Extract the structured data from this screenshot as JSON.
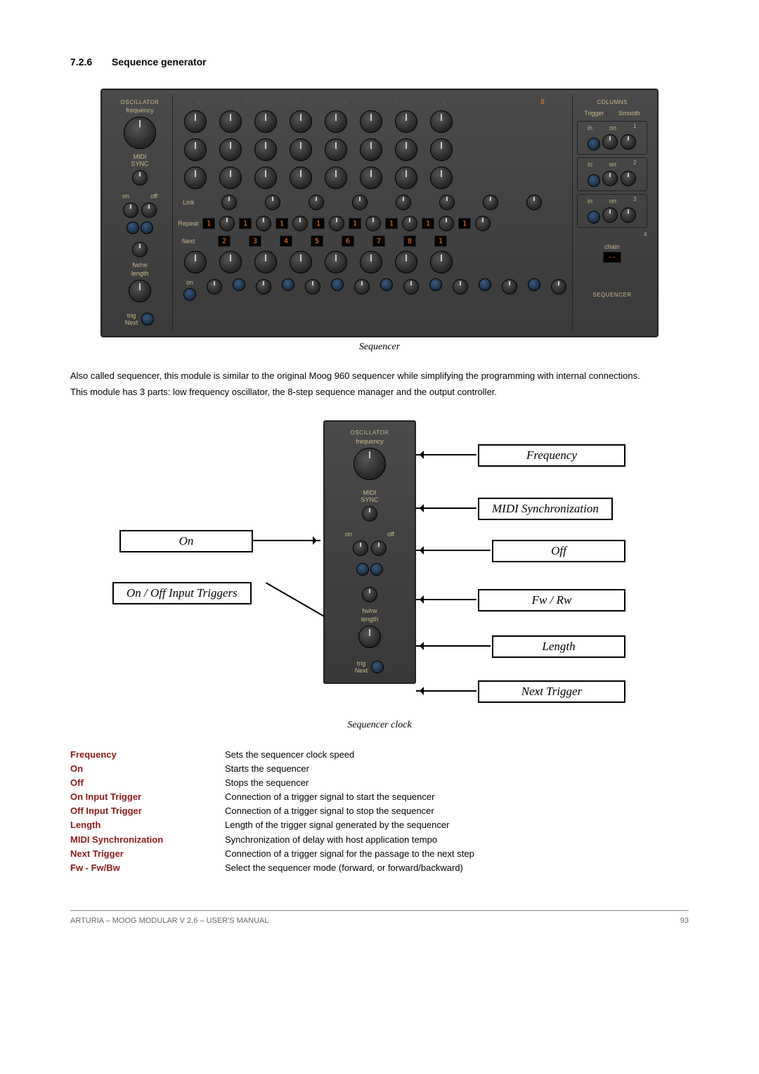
{
  "section": {
    "number": "7.2.6",
    "title": "Sequence generator"
  },
  "panel": {
    "osc_label": "OSCILLATOR",
    "freq_label": "frequency",
    "midi_sync": "MIDI\nSYNC",
    "on": "on",
    "off": "off",
    "fwrw": "fw/rw",
    "length": "length",
    "trig_next": "trig\nNext",
    "columns": "COLUMNS",
    "trigger": "Trigger",
    "smooth": "Smooth",
    "in": "in",
    "link": "Link",
    "repeat": "Repeat",
    "next": "Next",
    "chain": "chain",
    "chain_val": "--",
    "sequencer": "SEQUENCER",
    "step_nums": [
      "1",
      "2",
      "3",
      "4",
      "5",
      "6",
      "7",
      "8"
    ],
    "repeat_vals": [
      "1",
      "1",
      "1",
      "1",
      "1",
      "1",
      "1",
      "1"
    ],
    "next_vals": [
      "2",
      "3",
      "4",
      "5",
      "6",
      "7",
      "8",
      "1"
    ]
  },
  "captions": {
    "seq": "Sequencer",
    "clock": "Sequencer clock"
  },
  "paragraphs": {
    "p1": "Also called sequencer, this module is similar to the original Moog 960 sequencer while simplifying the programming with internal connections.",
    "p2": "This module has 3 parts: low frequency oscillator, the 8-step sequence manager and the output controller."
  },
  "clock_labels": {
    "frequency": "Frequency",
    "midi_sync": "MIDI Synchronization",
    "on": "On",
    "off": "Off",
    "onoff_trig": "On / Off Input Triggers",
    "fwrw": "Fw / Rw",
    "length": "Length",
    "next_trigger": "Next Trigger"
  },
  "defs": [
    {
      "term": "Frequency",
      "desc": "Sets the sequencer clock speed"
    },
    {
      "term": "On",
      "desc": "Starts the sequencer"
    },
    {
      "term": "Off",
      "desc": "Stops the sequencer"
    },
    {
      "term": "On Input Trigger",
      "desc": "Connection of a trigger signal to start the sequencer"
    },
    {
      "term": "Off Input Trigger",
      "desc": "Connection of a trigger signal to stop the sequencer"
    },
    {
      "term": "Length",
      "desc": "Length of the trigger signal generated by the sequencer"
    },
    {
      "term": "MIDI Synchronization",
      "desc": "Synchronization of delay with host application tempo"
    },
    {
      "term": "Next Trigger",
      "desc": "Connection of a trigger signal for the passage to the next step"
    },
    {
      "term": "Fw - Fw/Bw",
      "desc": "Select the sequencer mode (forward, or forward/backward)"
    }
  ],
  "footer": {
    "left": "ARTURIA – MOOG MODULAR V 2.6 – USER'S MANUAL",
    "right": "93"
  }
}
